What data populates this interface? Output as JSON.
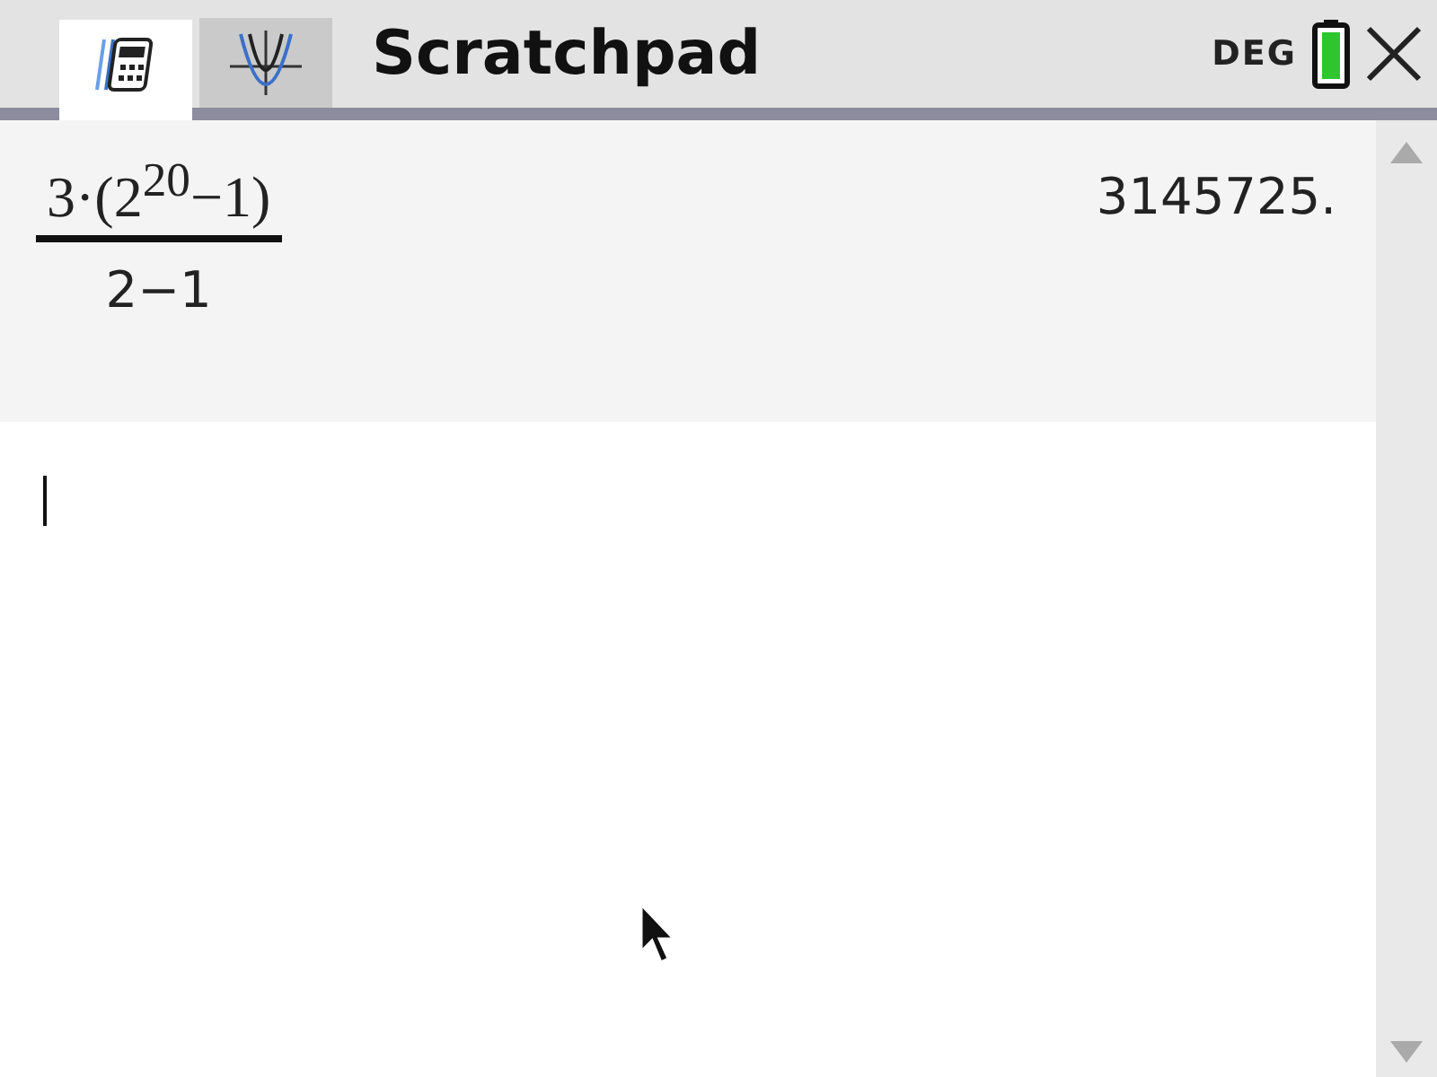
{
  "tabs": [
    {
      "kind": "calculator",
      "selected": true
    },
    {
      "kind": "graph",
      "selected": false
    }
  ],
  "title": "Scratchpad",
  "angle_mode": "DEG",
  "history": [
    {
      "numerator": "3·(2$^{20}$−1)",
      "denominator": "2−1",
      "result": "3145725."
    }
  ],
  "entry": {
    "cursor": true
  }
}
